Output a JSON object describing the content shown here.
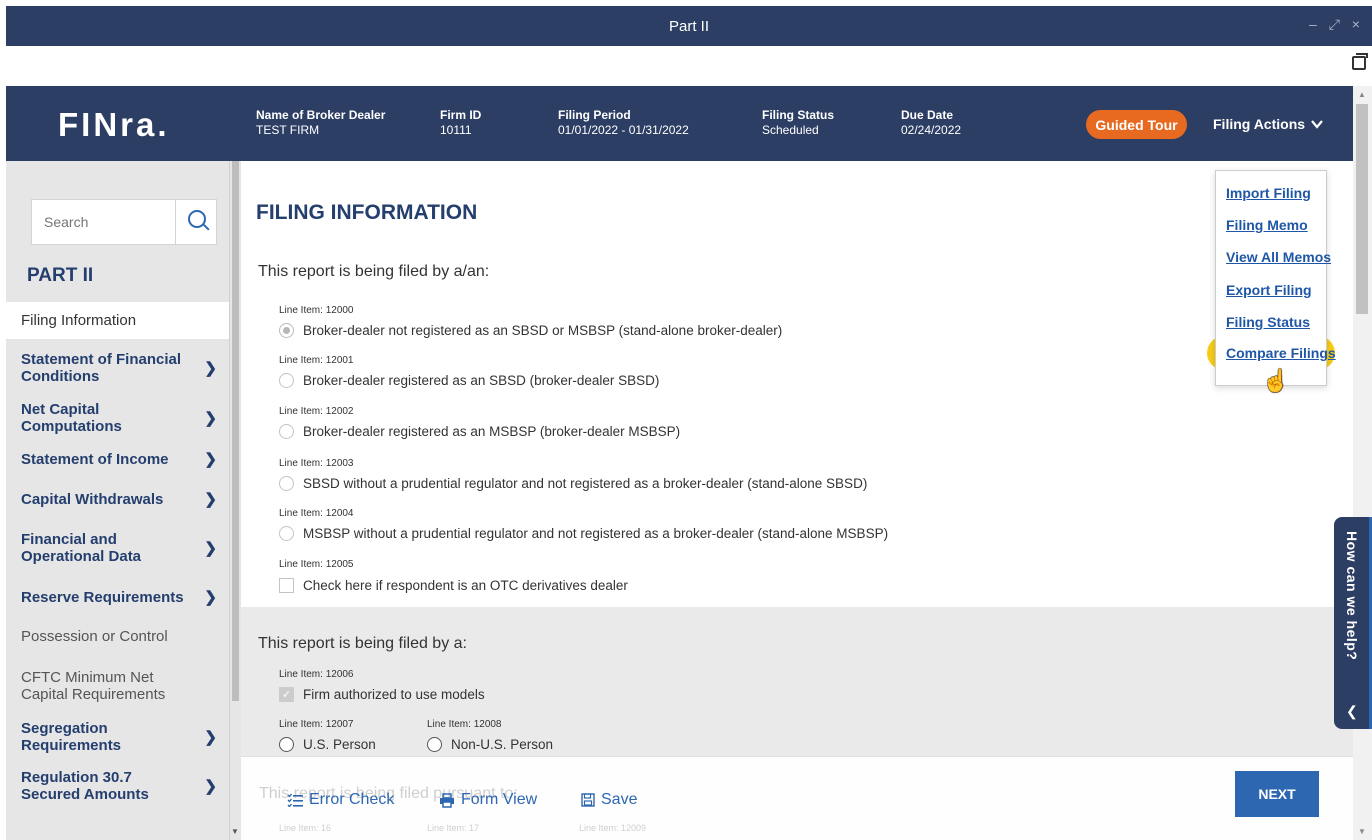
{
  "window": {
    "title": "Part II",
    "controls": "– ⤢ ×"
  },
  "header": {
    "logo": "FINra.",
    "fields": [
      {
        "label": "Name of Broker Dealer",
        "value": "TEST FIRM"
      },
      {
        "label": "Firm ID",
        "value": "10111"
      },
      {
        "label": "Filing Period",
        "value": "01/01/2022 - 01/31/2022"
      },
      {
        "label": "Filing Status",
        "value": "Scheduled"
      },
      {
        "label": "Due Date",
        "value": "02/24/2022"
      }
    ],
    "guided_tour": "Guided Tour",
    "filing_actions": "Filing Actions",
    "filing_actions_icon": "chevron-down-icon"
  },
  "sidebar": {
    "search_placeholder": "Search",
    "title": "PART II",
    "items": [
      {
        "label": "Filing Information"
      },
      {
        "label": "Statement of Financial Conditions"
      },
      {
        "label": "Net Capital Computations"
      },
      {
        "label": "Statement of Income"
      },
      {
        "label": "Capital Withdrawals"
      },
      {
        "label": "Financial and Operational Data"
      },
      {
        "label": "Reserve Requirements"
      },
      {
        "label": "Possession or Control"
      },
      {
        "label": "CFTC Minimum Net Capital Requirements"
      },
      {
        "label": "Segregation Requirements"
      },
      {
        "label": "Regulation 30.7 Secured Amounts"
      }
    ]
  },
  "main": {
    "title": "FILING INFORMATION",
    "section1_title": "This report is being filed by a/an:",
    "section1_items": [
      {
        "line": "Line Item: 12000",
        "text": "Broker-dealer not registered as an SBSD or MSBSP (stand-alone broker-dealer)"
      },
      {
        "line": "Line Item: 12001",
        "text": "Broker-dealer registered as an SBSD (broker-dealer SBSD)"
      },
      {
        "line": "Line Item: 12002",
        "text": "Broker-dealer registered as an MSBSP (broker-dealer MSBSP)"
      },
      {
        "line": "Line Item: 12003",
        "text": "SBSD without a prudential regulator and not registered as a broker-dealer (stand-alone SBSD)"
      },
      {
        "line": "Line Item: 12004",
        "text": "MSBSP without a prudential regulator and not registered as a broker-dealer (stand-alone MSBSP)"
      },
      {
        "line": "Line Item: 12005",
        "text": "Check here if respondent is an OTC derivatives dealer"
      }
    ],
    "section2_title": "This report is being filed by a:",
    "section2_item": {
      "line": "Line Item: 12006",
      "text": "Firm authorized to use models"
    },
    "person_options": [
      {
        "line": "Line Item: 12007",
        "text": "U.S. Person"
      },
      {
        "line": "Line Item: 12008",
        "text": "Non-U.S. Person"
      }
    ]
  },
  "footer": {
    "ghost_text": "This report is being filed pursuant to:",
    "ghost_lines": [
      "Line Item: 16",
      "Line Item: 17",
      "Line Item: 12009"
    ],
    "error_check": "Error Check",
    "form_view": "Form View",
    "save": "Save",
    "next": "NEXT"
  },
  "dropdown": {
    "items": [
      "Import Filing",
      "Filing Memo",
      "View All Memos",
      "Export Filing",
      "Filing Status",
      "Compare Filings"
    ],
    "highlight_color": "#f7cc16"
  },
  "help": {
    "label": "How can we help?"
  },
  "colors": {
    "navy": "#2d3e64",
    "accent": "#e86a21",
    "link": "#2d67b2"
  }
}
